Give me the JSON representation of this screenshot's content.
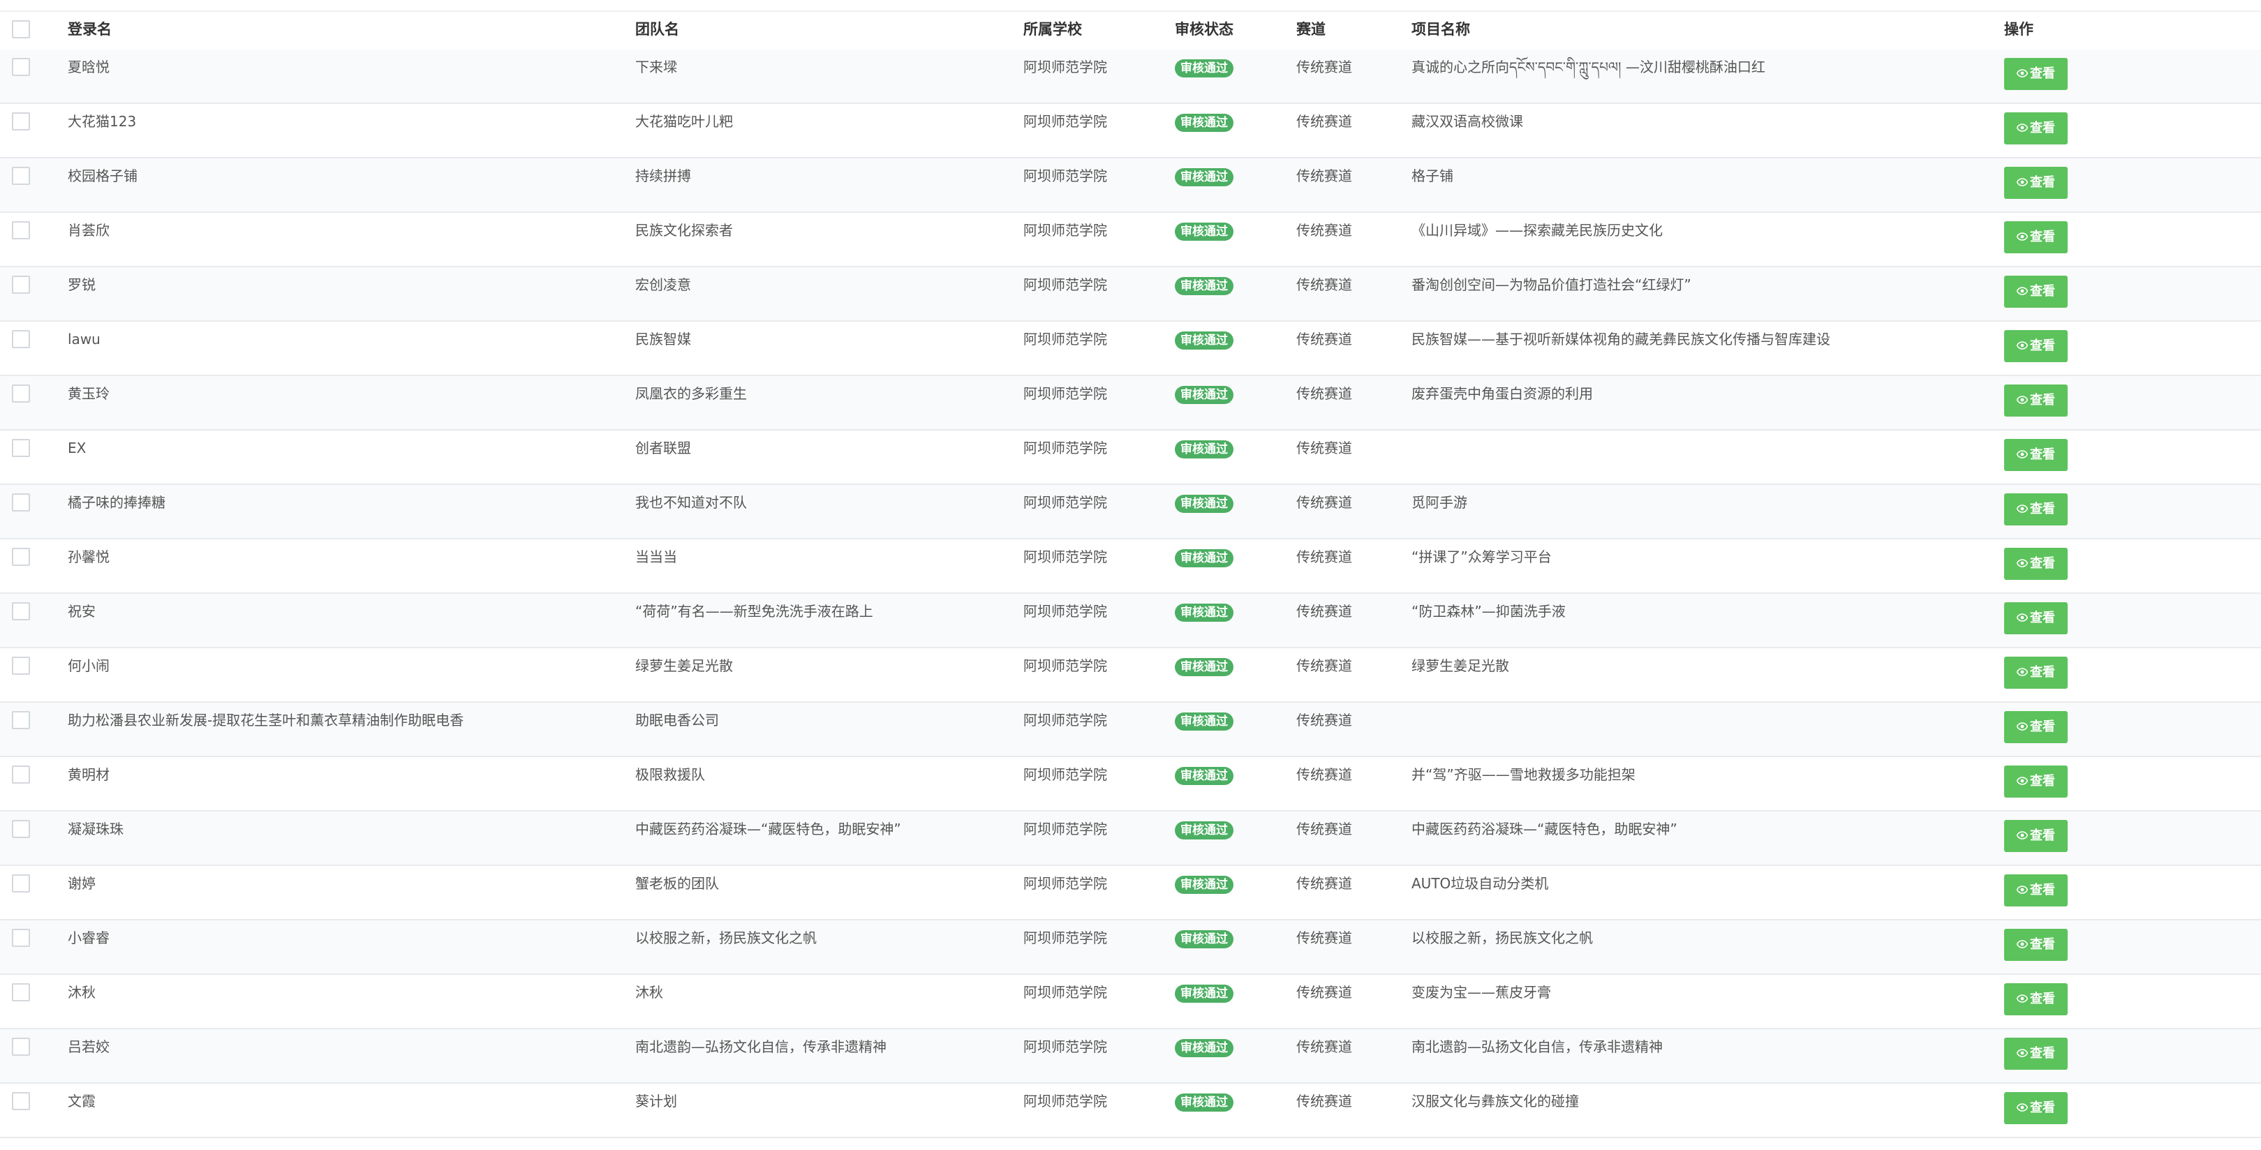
{
  "columns": {
    "login": "登录名",
    "team": "团队名",
    "school": "所属学校",
    "status": "审核状态",
    "track": "赛道",
    "project": "项目名称",
    "action": "操作"
  },
  "view_label": "查看",
  "colors": {
    "badge": "#4caf63",
    "button": "#5cc25c",
    "stripe": "#f9fafb"
  },
  "rows": [
    {
      "login": "夏晗悦",
      "team": "下来墚",
      "school": "阿坝师范学院",
      "status": "审核通过",
      "track": "传统赛道",
      "project": "真诚的心之所向དངོས་དབང་གི་ཀླུ་དཔལ། —汶川甜樱桃酥油口红"
    },
    {
      "login": "大花猫123",
      "team": "大花猫吃叶儿粑",
      "school": "阿坝师范学院",
      "status": "审核通过",
      "track": "传统赛道",
      "project": "藏汉双语高校微课"
    },
    {
      "login": "校园格子铺",
      "team": "持续拼搏",
      "school": "阿坝师范学院",
      "status": "审核通过",
      "track": "传统赛道",
      "project": "格子铺"
    },
    {
      "login": "肖荟欣",
      "team": "民族文化探索者",
      "school": "阿坝师范学院",
      "status": "审核通过",
      "track": "传统赛道",
      "project": "《山川异域》——探索藏羌民族历史文化"
    },
    {
      "login": "罗锐",
      "team": "宏创凌意",
      "school": "阿坝师范学院",
      "status": "审核通过",
      "track": "传统赛道",
      "project": "番淘创创空间—为物品价值打造社会“红绿灯”"
    },
    {
      "login": "lawu",
      "team": "民族智媒",
      "school": "阿坝师范学院",
      "status": "审核通过",
      "track": "传统赛道",
      "project": "民族智媒——基于视听新媒体视角的藏羌彝民族文化传播与智库建设"
    },
    {
      "login": "黄玉玲",
      "team": "凤凰衣的多彩重生",
      "school": "阿坝师范学院",
      "status": "审核通过",
      "track": "传统赛道",
      "project": "废弃蛋壳中角蛋白资源的利用"
    },
    {
      "login": "EX",
      "team": "创者联盟",
      "school": "阿坝师范学院",
      "status": "审核通过",
      "track": "传统赛道",
      "project": ""
    },
    {
      "login": "橘子味的捧捧糖",
      "team": "我也不知道对不队",
      "school": "阿坝师范学院",
      "status": "审核通过",
      "track": "传统赛道",
      "project": "觅阿手游"
    },
    {
      "login": "孙馨悦",
      "team": "当当当",
      "school": "阿坝师范学院",
      "status": "审核通过",
      "track": "传统赛道",
      "project": "“拼课了”众筹学习平台"
    },
    {
      "login": "祝安",
      "team": "“荷荷”有名——新型免洗洗手液在路上",
      "school": "阿坝师范学院",
      "status": "审核通过",
      "track": "传统赛道",
      "project": "“防卫森林”—抑菌洗手液"
    },
    {
      "login": "何小闹",
      "team": "绿萝生姜足光散",
      "school": "阿坝师范学院",
      "status": "审核通过",
      "track": "传统赛道",
      "project": "绿萝生姜足光散"
    },
    {
      "login": "助力松潘县农业新发展-提取花生茎叶和薰衣草精油制作助眠电香",
      "team": "助眠电香公司",
      "school": "阿坝师范学院",
      "status": "审核通过",
      "track": "传统赛道",
      "project": ""
    },
    {
      "login": "黄明材",
      "team": "极限救援队",
      "school": "阿坝师范学院",
      "status": "审核通过",
      "track": "传统赛道",
      "project": "并“驾”齐驱——雪地救援多功能担架"
    },
    {
      "login": "凝凝珠珠",
      "team": "中藏医药药浴凝珠—“藏医特色，助眠安神”",
      "school": "阿坝师范学院",
      "status": "审核通过",
      "track": "传统赛道",
      "project": "中藏医药药浴凝珠—“藏医特色，助眠安神”"
    },
    {
      "login": "谢婷",
      "team": "蟹老板的团队",
      "school": "阿坝师范学院",
      "status": "审核通过",
      "track": "传统赛道",
      "project": "AUTO垃圾自动分类机"
    },
    {
      "login": "小睿睿",
      "team": "以校服之新，扬民族文化之帆",
      "school": "阿坝师范学院",
      "status": "审核通过",
      "track": "传统赛道",
      "project": "以校服之新，扬民族文化之帆"
    },
    {
      "login": "沐秋",
      "team": "沐秋",
      "school": "阿坝师范学院",
      "status": "审核通过",
      "track": "传统赛道",
      "project": "变废为宝——蕉皮牙膏"
    },
    {
      "login": "吕若姣",
      "team": "南北遗韵—弘扬文化自信，传承非遗精神",
      "school": "阿坝师范学院",
      "status": "审核通过",
      "track": "传统赛道",
      "project": "南北遗韵—弘扬文化自信，传承非遗精神"
    },
    {
      "login": "文霞",
      "team": "葵计划",
      "school": "阿坝师范学院",
      "status": "审核通过",
      "track": "传统赛道",
      "project": "汉服文化与彝族文化的碰撞"
    }
  ]
}
